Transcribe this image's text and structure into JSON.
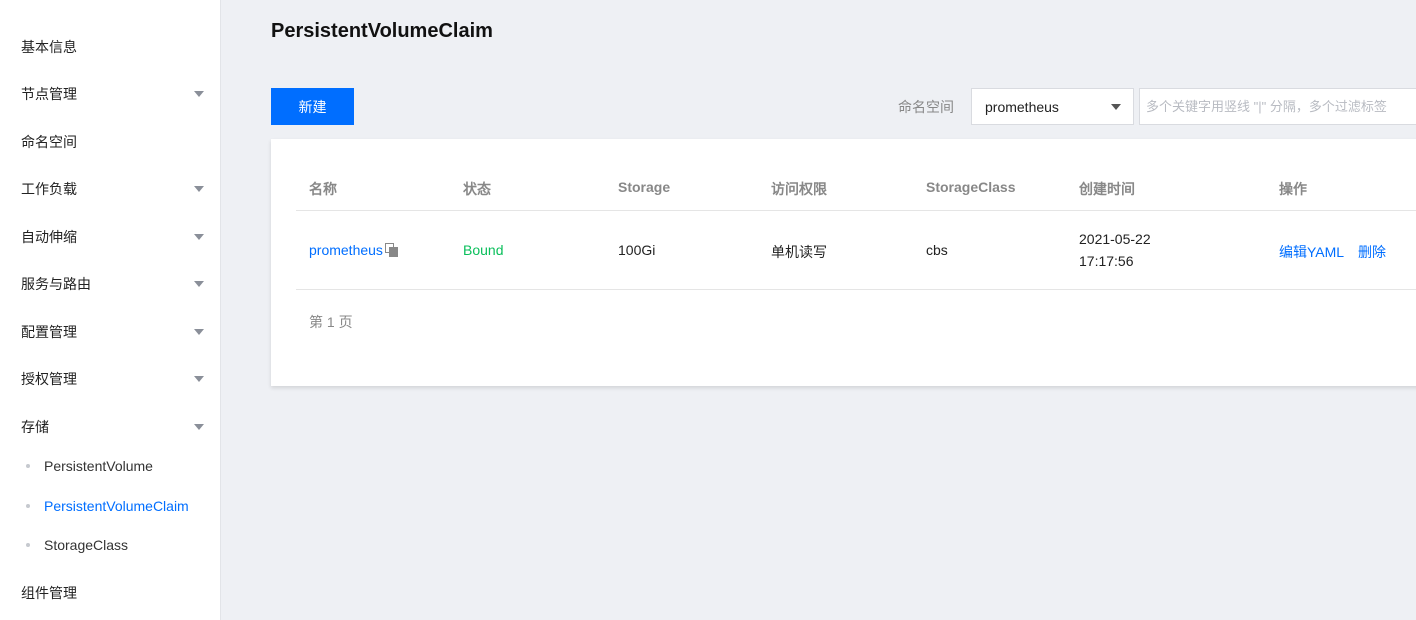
{
  "sidebar": {
    "items": [
      {
        "label": "基本信息"
      },
      {
        "label": "节点管理"
      },
      {
        "label": "命名空间"
      },
      {
        "label": "工作负载"
      },
      {
        "label": "自动伸缩"
      },
      {
        "label": "服务与路由"
      },
      {
        "label": "配置管理"
      },
      {
        "label": "授权管理"
      },
      {
        "label": "存储"
      },
      {
        "label": "组件管理"
      }
    ],
    "storage_subitems": [
      {
        "label": "PersistentVolume"
      },
      {
        "label": "PersistentVolumeClaim",
        "active": true
      },
      {
        "label": "StorageClass"
      }
    ]
  },
  "main": {
    "title": "PersistentVolumeClaim",
    "new_button": "新建",
    "namespace_label": "命名空间",
    "namespace_value": "prometheus",
    "search_placeholder": "多个关键字用竖线 \"|\" 分隔，多个过滤标签",
    "table": {
      "headers": [
        "名称",
        "状态",
        "Storage",
        "访问权限",
        "StorageClass",
        "创建时间",
        "操作"
      ],
      "rows": [
        {
          "name": "prometheus",
          "status": "Bound",
          "storage": "100Gi",
          "access": "单机读写",
          "storage_class": "cbs",
          "created_date": "2021-05-22",
          "created_time": "17:17:56",
          "actions": [
            "编辑YAML",
            "删除"
          ]
        }
      ]
    },
    "pager": "第 1 页"
  },
  "colors": {
    "accent": "#006eff",
    "status_bound": "#0abf5b"
  }
}
